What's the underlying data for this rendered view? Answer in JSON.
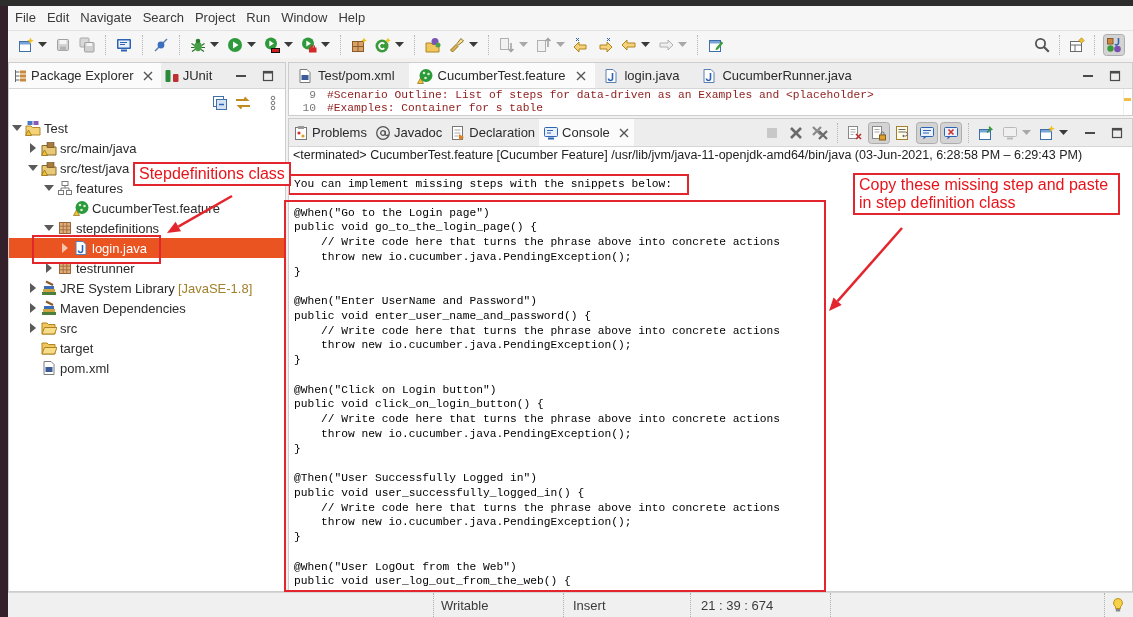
{
  "menu": [
    "File",
    "Edit",
    "Navigate",
    "Search",
    "Project",
    "Run",
    "Window",
    "Help"
  ],
  "toolbar_right": [
    {
      "kind": "search"
    },
    {
      "kind": "separator"
    },
    {
      "kind": "open-perspective"
    },
    {
      "kind": "separator"
    },
    {
      "kind": "java-perspective",
      "selected": true
    }
  ],
  "left_view": {
    "tabs": [
      {
        "label": "Package Explorer",
        "kind": "package-explorer",
        "selected": true
      },
      {
        "label": "JUnit",
        "kind": "junit",
        "selected": false
      }
    ],
    "tree": [
      {
        "label": "Test",
        "kind": "project",
        "expanded": true,
        "selected": false,
        "children": [
          {
            "label": "src/main/java",
            "kind": "source-folder",
            "expanded": false,
            "selected": false
          },
          {
            "label": "src/test/java",
            "kind": "source-folder",
            "expanded": true,
            "selected": false,
            "children": [
              {
                "label": "features",
                "kind": "resource-folder",
                "expanded": true,
                "selected": false,
                "children": [
                  {
                    "label": "CucumberTest.feature",
                    "kind": "feature",
                    "selected": false
                  }
                ]
              },
              {
                "label": "stepdefinitions",
                "kind": "package",
                "expanded": true,
                "selected": false,
                "children": [
                  {
                    "label": "login.java",
                    "kind": "java",
                    "expanded": false,
                    "selected": true
                  }
                ]
              },
              {
                "label": "testrunner",
                "kind": "package",
                "expanded": false,
                "selected": false
              }
            ]
          },
          {
            "label": "JRE System Library",
            "decoration": "[JavaSE-1.8]",
            "kind": "library",
            "expanded": false,
            "selected": false
          },
          {
            "label": "Maven Dependencies",
            "kind": "library",
            "expanded": false,
            "selected": false
          },
          {
            "label": "src",
            "kind": "folder",
            "expanded": false,
            "selected": false
          },
          {
            "label": "target",
            "kind": "folder",
            "selected": false
          },
          {
            "label": "pom.xml",
            "kind": "xml",
            "selected": false
          }
        ]
      }
    ]
  },
  "editor": {
    "tabs": [
      {
        "label": "Test/pom.xml",
        "kind": "xml",
        "selected": false
      },
      {
        "label": "CucumberTest.feature",
        "kind": "feature",
        "selected": true
      },
      {
        "label": "login.java",
        "kind": "java",
        "selected": false
      },
      {
        "label": "CucumberRunner.java",
        "kind": "java",
        "selected": false
      }
    ],
    "lines": [
      {
        "number": "9",
        "text": "#Scenario Outline: List of steps for data-driven as an Examples and <placeholder>"
      },
      {
        "number": "10",
        "text": "#Examples: Container for s table"
      }
    ]
  },
  "bottom_view": {
    "tabs": [
      {
        "label": "Problems",
        "kind": "problems",
        "selected": false
      },
      {
        "label": "Javadoc",
        "kind": "javadoc",
        "selected": false
      },
      {
        "label": "Declaration",
        "kind": "declaration",
        "selected": false
      },
      {
        "label": "Console",
        "kind": "console",
        "selected": true
      }
    ],
    "toolbar": [
      {
        "kind": "terminate",
        "enabled": false
      },
      {
        "kind": "remove",
        "enabled": true
      },
      {
        "kind": "remove-all",
        "enabled": true
      },
      {
        "kind": "separator"
      },
      {
        "kind": "clear",
        "enabled": true
      },
      {
        "kind": "scroll-lock",
        "enabled": true,
        "pressed": true
      },
      {
        "kind": "word-wrap",
        "enabled": true,
        "pressed": false
      },
      {
        "kind": "stdout",
        "enabled": true,
        "pressed": true
      },
      {
        "kind": "stderr",
        "enabled": true,
        "pressed": true
      },
      {
        "kind": "separator"
      },
      {
        "kind": "pin",
        "enabled": true
      },
      {
        "kind": "display-console",
        "enabled": false,
        "dropdown": true
      },
      {
        "kind": "open-console",
        "enabled": true,
        "dropdown": true
      }
    ],
    "process": "<terminated> CucumberTest.feature [Cucumber Feature] /usr/lib/jvm/java-11-openjdk-amd64/bin/java (03-Jun-2021, 6:28:58 PM – 6:29:43 PM)",
    "console": {
      "intro": {
        "text": "You can implement missing steps with the snippets below:",
        "highlighted": true
      },
      "snippets": [
        {
          "annotation": "@When(\"Go to the Login page\")",
          "signature": "public void go_to_the_login_page() {",
          "body": [
            "// Write code here that turns the phrase above into concrete actions",
            "throw new io.cucumber.java.PendingException();"
          ],
          "closing": "}"
        },
        {
          "annotation": "@When(\"Enter UserName and Password\")",
          "signature": "public void enter_user_name_and_password() {",
          "body": [
            "// Write code here that turns the phrase above into concrete actions",
            "throw new io.cucumber.java.PendingException();"
          ],
          "closing": "}"
        },
        {
          "annotation": "@When(\"Click on Login button\")",
          "signature": "public void click_on_login_button() {",
          "body": [
            "// Write code here that turns the phrase above into concrete actions",
            "throw new io.cucumber.java.PendingException();"
          ],
          "closing": "}"
        },
        {
          "annotation": "@Then(\"User Successfully Logged in\")",
          "signature": "public void user_successfully_logged_in() {",
          "body": [
            "// Write code here that turns the phrase above into concrete actions",
            "throw new io.cucumber.java.PendingException();"
          ],
          "closing": "}"
        },
        {
          "annotation": "@When(\"User LogOut from the Web\")",
          "signature": "public void user_log_out_from_the_web() {"
        }
      ]
    }
  },
  "status_bar": {
    "mode": "Writable",
    "insert_mode": "Insert",
    "position": "21 : 39 : 674"
  },
  "annotations": [
    {
      "kind": "callout",
      "text": "Stepdefinitions class"
    },
    {
      "kind": "arrow"
    },
    {
      "kind": "highlight"
    },
    {
      "kind": "highlight"
    },
    {
      "kind": "callout",
      "text": "Copy these missing step and paste\nin step definition class"
    },
    {
      "kind": "arrow"
    }
  ]
}
